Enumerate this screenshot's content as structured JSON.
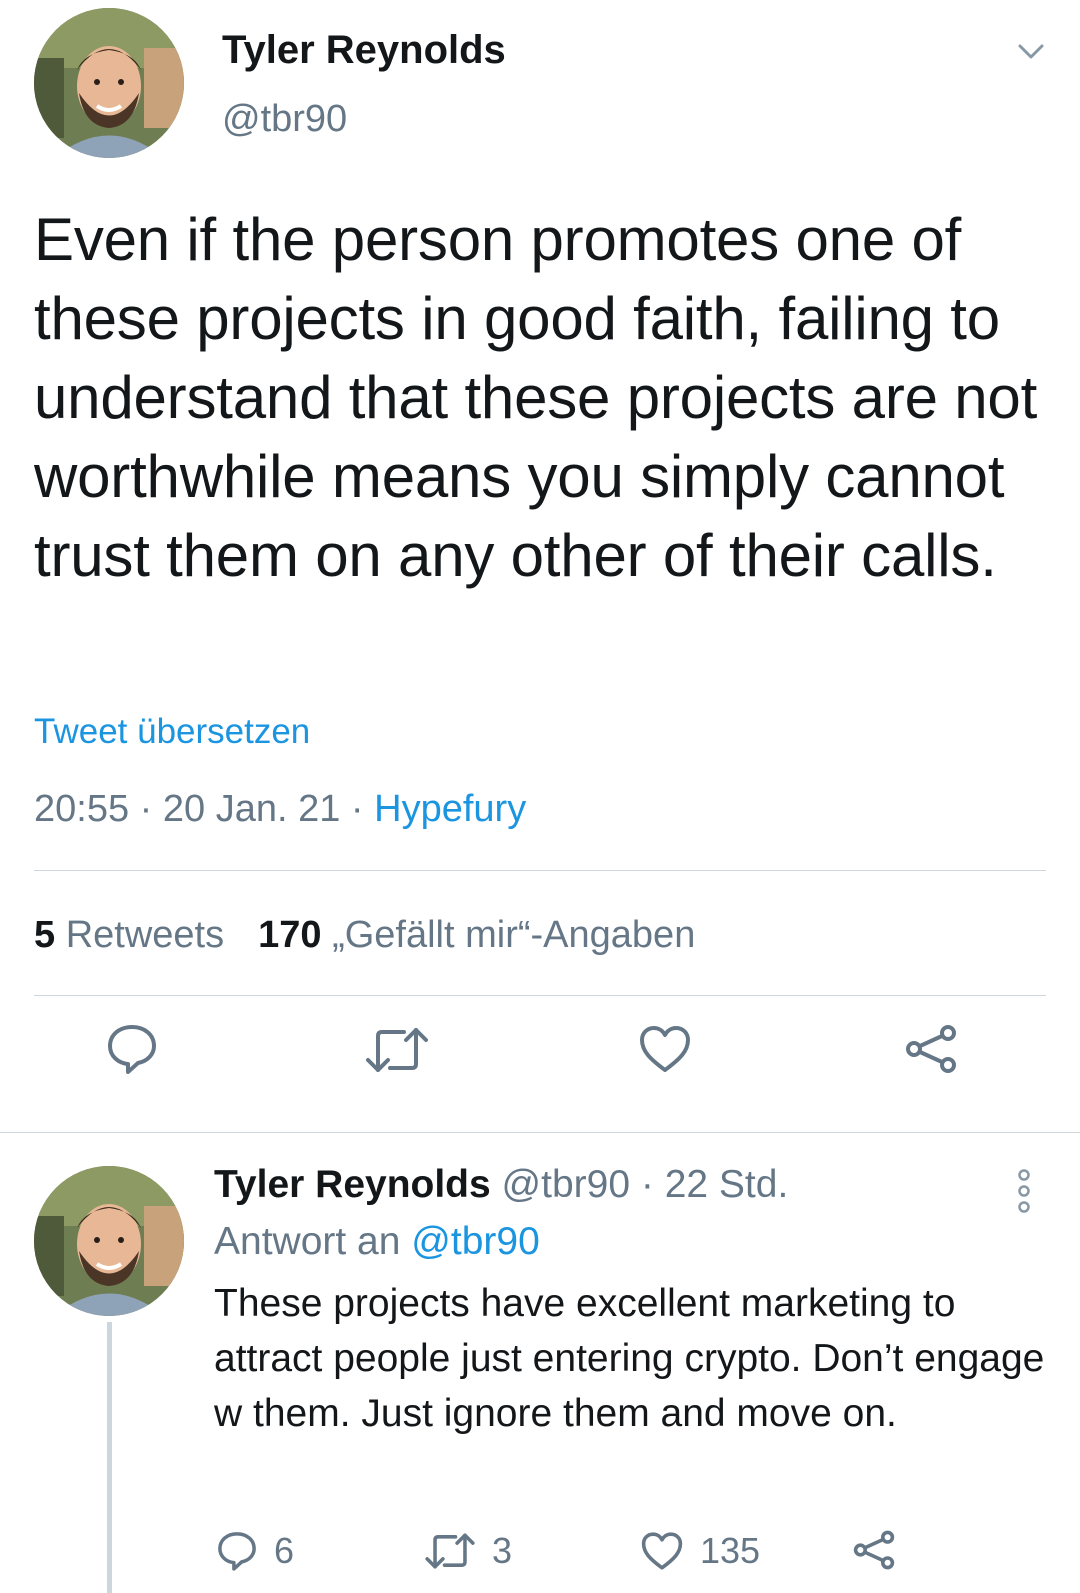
{
  "tweet": {
    "author_name": "Tyler Reynolds",
    "author_handle": "@tbr90",
    "text": "Even if the person promotes one of these projects in good faith, failing to understand that these projects are not worthwhile means you simply cannot trust them on any other of their calls.",
    "translate_label": "Tweet übersetzen",
    "time": "20:55",
    "date": "20 Jan. 21",
    "source": "Hypefury",
    "separator": " · ",
    "retweet_count": "5",
    "retweet_label": "Retweets",
    "like_count": "170",
    "like_label": "„Gefällt mir“-Angaben",
    "actions": [
      "reply-icon",
      "retweet-icon",
      "like-icon",
      "share-icon"
    ]
  },
  "reply": {
    "author_name": "Tyler Reynolds",
    "author_handle": "@tbr90",
    "age": "22 Std.",
    "separator": " · ",
    "reply_to_label": "Antwort an ",
    "reply_to_handle": "@tbr90",
    "text": "These projects have excellent marketing to attract people just entering crypto. Don’t engage w them. Just ignore them and move on.",
    "reply_count": "6",
    "retweet_count": "3",
    "like_count": "135"
  },
  "colors": {
    "text": "#14171a",
    "secondary": "#657786",
    "link": "#1b95e0",
    "divider": "#ccd6dd"
  }
}
